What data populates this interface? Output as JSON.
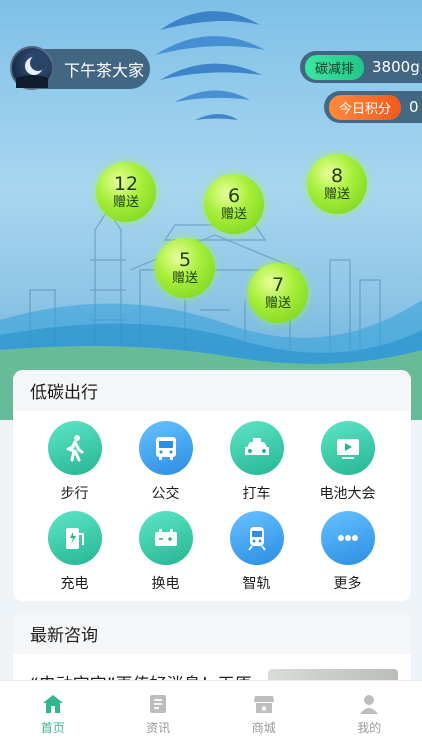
{
  "user": {
    "name": "下午茶大家"
  },
  "stats": {
    "carbon_label": "碳减排",
    "carbon_value": "3800g",
    "points_label": "今日积分",
    "points_value": "0"
  },
  "bubbles": [
    {
      "value": "12",
      "label": "赠送"
    },
    {
      "value": "6",
      "label": "赠送"
    },
    {
      "value": "8",
      "label": "赠送"
    },
    {
      "value": "5",
      "label": "赠送"
    },
    {
      "value": "7",
      "label": "赠送"
    }
  ],
  "low_carbon": {
    "title": "低碳出行",
    "items": [
      {
        "label": "步行",
        "icon": "walk-icon"
      },
      {
        "label": "公交",
        "icon": "bus-icon"
      },
      {
        "label": "打车",
        "icon": "taxi-icon"
      },
      {
        "label": "电池大会",
        "icon": "video-icon"
      },
      {
        "label": "充电",
        "icon": "charging-station-icon"
      },
      {
        "label": "换电",
        "icon": "battery-icon"
      },
      {
        "label": "智轨",
        "icon": "train-icon"
      },
      {
        "label": "更多",
        "icon": "more-icon"
      }
    ]
  },
  "news": {
    "title": "最新咨询",
    "headline": "“电动宝宝”再传好消息！天原"
  },
  "tabbar": [
    {
      "label": "首页",
      "icon": "home-icon",
      "active": true
    },
    {
      "label": "资讯",
      "icon": "news-icon",
      "active": false
    },
    {
      "label": "商城",
      "icon": "shop-icon",
      "active": false
    },
    {
      "label": "我的",
      "icon": "profile-icon",
      "active": false
    }
  ],
  "colors": {
    "accent": "#33b68f",
    "bubble_green": "#a8ef3c",
    "carbon_tag": "#22c78b",
    "points_tag": "#f25a1e"
  }
}
